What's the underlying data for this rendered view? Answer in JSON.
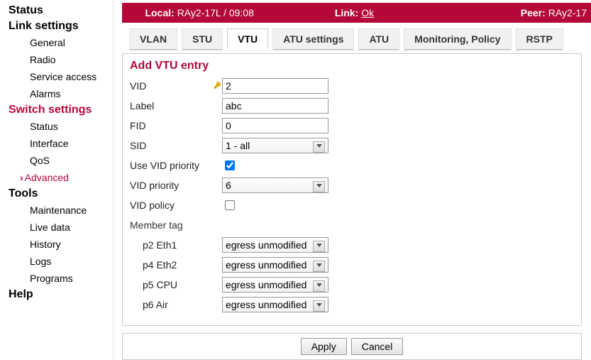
{
  "nav": {
    "status": "Status",
    "link_settings": "Link settings",
    "general": "General",
    "radio": "Radio",
    "service_access": "Service access",
    "alarms": "Alarms",
    "switch_settings": "Switch settings",
    "sw_status": "Status",
    "interface": "Interface",
    "qos": "QoS",
    "advanced": "Advanced",
    "tools": "Tools",
    "maintenance": "Maintenance",
    "live_data": "Live data",
    "history": "History",
    "logs": "Logs",
    "programs": "Programs",
    "help": "Help"
  },
  "status": {
    "local_label": "Local:",
    "local_value": "RAy2-17L / 09:08",
    "link_label": "Link:",
    "link_value": "Ok",
    "peer_label": "Peer:",
    "peer_value": "RAy2-17"
  },
  "tabs": {
    "vlan": "VLAN",
    "stu": "STU",
    "vtu": "VTU",
    "atu_settings": "ATU settings",
    "atu": "ATU",
    "monitoring": "Monitoring, Policy",
    "rstp": "RSTP"
  },
  "form": {
    "title": "Add VTU entry",
    "vid_label": "VID",
    "vid_value": "2",
    "label_label": "Label",
    "label_value": "abc",
    "fid_label": "FID",
    "fid_value": "0",
    "sid_label": "SID",
    "sid_value": "1 - all",
    "use_vid_prio_label": "Use VID priority",
    "use_vid_prio_checked": true,
    "vid_prio_label": "VID priority",
    "vid_prio_value": "6",
    "vid_policy_label": "VID policy",
    "vid_policy_checked": false,
    "member_tag_label": "Member tag",
    "ports": [
      {
        "label": "p2 Eth1",
        "value": "egress unmodified"
      },
      {
        "label": "p4 Eth2",
        "value": "egress unmodified"
      },
      {
        "label": "p5 CPU",
        "value": "egress unmodified"
      },
      {
        "label": "p6 Air",
        "value": "egress unmodified"
      }
    ]
  },
  "buttons": {
    "apply": "Apply",
    "cancel": "Cancel"
  }
}
